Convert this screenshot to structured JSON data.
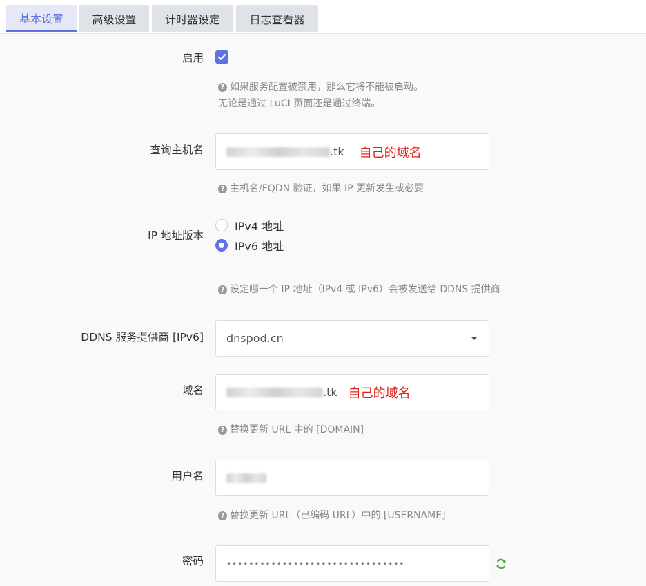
{
  "tabs": [
    {
      "label": "基本设置",
      "active": true
    },
    {
      "label": "高级设置",
      "active": false
    },
    {
      "label": "计时器设定",
      "active": false
    },
    {
      "label": "日志查看器",
      "active": false
    }
  ],
  "enable": {
    "label": "启用",
    "checked": true,
    "help_line1": "如果服务配置被禁用，那么它将不能被启动。",
    "help_line2": "无论是通过 LuCI 页面还是通过终端。"
  },
  "lookup_host": {
    "label": "查询主机名",
    "value_suffix": ".tk",
    "annotation": "自己的域名",
    "help": "主机名/FQDN 验证，如果 IP 更新发生或必要"
  },
  "ip_version": {
    "label": "IP 地址版本",
    "options": [
      {
        "label": "IPv4 地址",
        "selected": false
      },
      {
        "label": "IPv6 地址",
        "selected": true
      }
    ],
    "help": "设定哪一个 IP 地址（IPv4 或 IPv6）会被发送给 DDNS 提供商"
  },
  "provider": {
    "label": "DDNS 服务提供商 [IPv6]",
    "value": "dnspod.cn"
  },
  "domain": {
    "label": "域名",
    "value_suffix": ".tk",
    "annotation": "自己的域名",
    "help": "替换更新 URL 中的 [DOMAIN]"
  },
  "username": {
    "label": "用户名",
    "help": "替换更新 URL（已编码 URL）中的 [USERNAME]"
  },
  "password": {
    "label": "密码",
    "masked": "••••••••••••••••••••••••••••••••"
  },
  "icons": {
    "help": "question-circle-icon",
    "reveal": "refresh-icon",
    "accent": "#5e72e4",
    "annotation_color": "#e0201c"
  }
}
